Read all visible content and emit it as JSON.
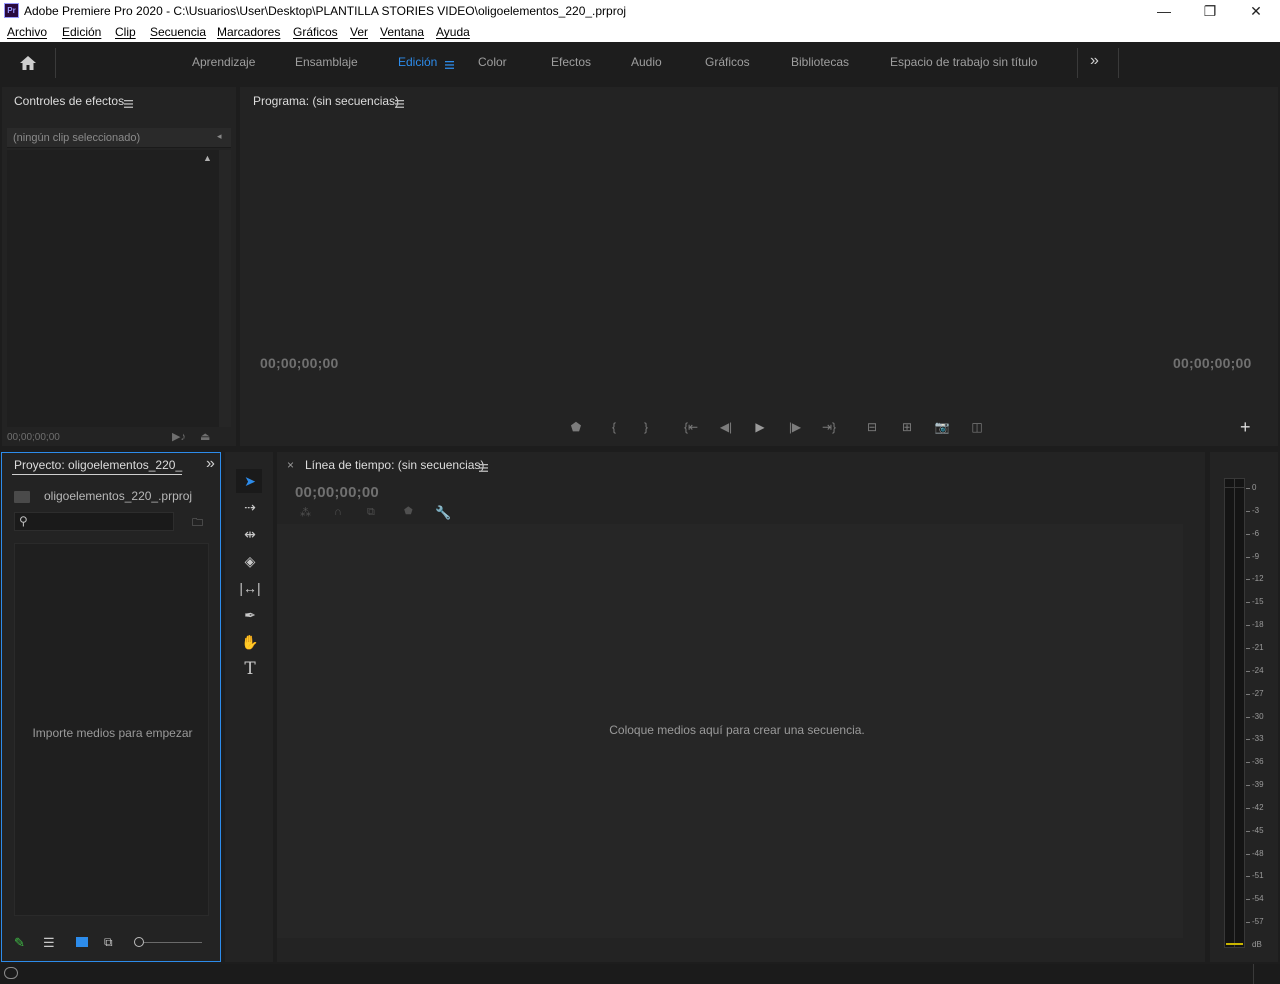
{
  "window": {
    "app_icon": "Pr",
    "title": "Adobe Premiere Pro 2020 - C:\\Usuarios\\User\\Desktop\\PLANTILLA STORIES VIDEO\\oligoelementos_220_.prproj",
    "minimize": "—",
    "maximize": "❐",
    "close": "✕"
  },
  "menu": [
    "Archivo",
    "Edición",
    "Clip",
    "Secuencia",
    "Marcadores",
    "Gráficos",
    "Ver",
    "Ventana",
    "Ayuda"
  ],
  "workspaces": {
    "tabs": [
      "Aprendizaje",
      "Ensamblaje",
      "Edición",
      "Color",
      "Efectos",
      "Audio",
      "Gráficos",
      "Bibliotecas",
      "Espacio de trabajo sin título"
    ],
    "active": "Edición",
    "overflow": "»"
  },
  "effect_controls": {
    "title": "Controles de efectos",
    "clip_placeholder": "(ningún clip seleccionado)",
    "timecode": "00;00;00;00"
  },
  "program": {
    "title": "Programa: (sin secuencias)",
    "timecode_left": "00;00;00;00",
    "timecode_right": "00;00;00;00",
    "add": "+"
  },
  "project": {
    "title": "Proyecto: oligoelementos_220_",
    "overflow": "»",
    "file": "oligoelementos_220_.prproj",
    "empty_message": "Importe medios para empezar"
  },
  "timeline": {
    "close": "×",
    "title": "Línea de tiempo: (sin secuencias)",
    "timecode": "00;00;00;00",
    "empty_message": "Coloque medios aquí para crear una secuencia."
  },
  "audio_meter": {
    "labels": [
      "0",
      "-3",
      "-6",
      "-9",
      "-12",
      "-15",
      "-18",
      "-21",
      "-24",
      "-27",
      "-30",
      "-33",
      "-36",
      "-39",
      "-42",
      "-45",
      "-48",
      "-51",
      "-54",
      "-57",
      "dB"
    ]
  },
  "colors": {
    "accent": "#2d8ceb",
    "panel": "#232323",
    "background": "#1d1d1d"
  }
}
